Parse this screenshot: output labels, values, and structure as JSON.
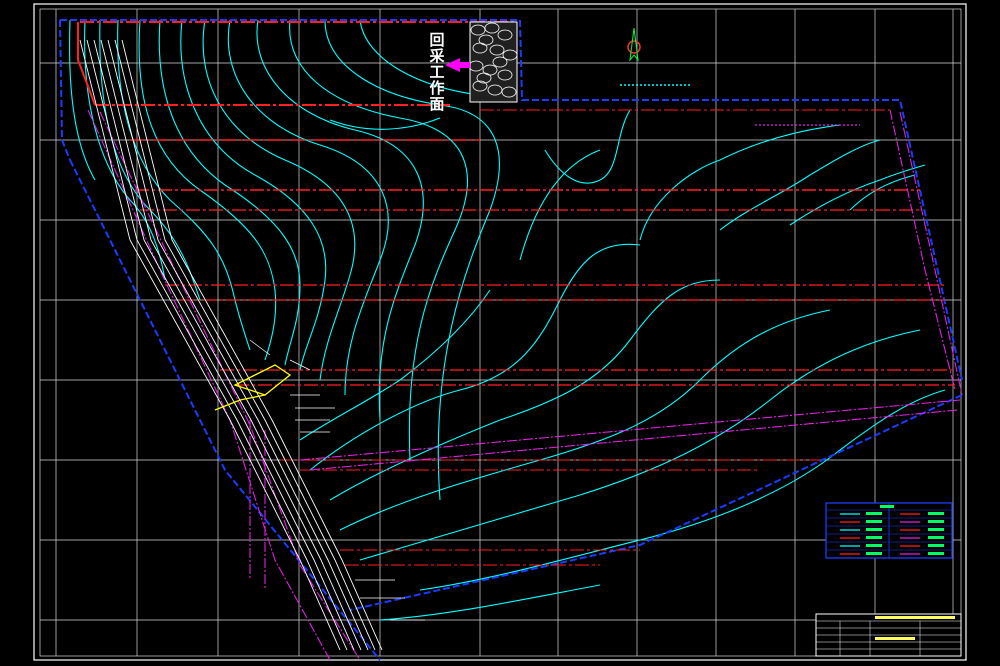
{
  "drawing": {
    "work_face_label_chars": [
      "回",
      "采",
      "工",
      "作",
      "面"
    ],
    "legend_title": "图 例"
  },
  "colors": {
    "background": "#000000",
    "frame": "#ffffff",
    "contour": "#00ffff",
    "boundary": "#1a3cff",
    "roadway": "#ff2020",
    "fault": "#e020e0",
    "arrow": "#ff00ff",
    "highlight": "#ffff00",
    "annotation": "#ffffff",
    "legend_green": "#00ff60"
  }
}
